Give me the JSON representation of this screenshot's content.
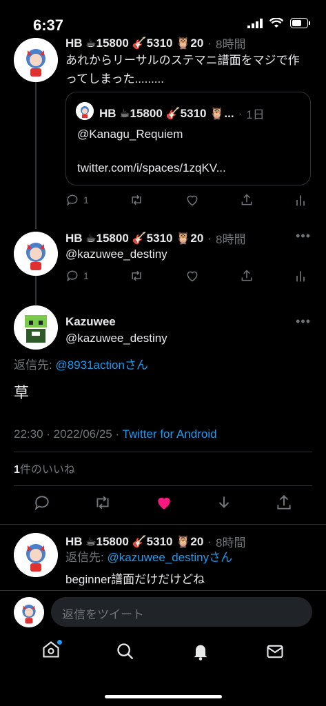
{
  "status_bar": {
    "time": "6:37"
  },
  "top_tweet": {
    "name": "HB ☕15800 🎸5310 🦉20",
    "time": "8時間",
    "text_line1": "あれからリーサルのステマニ譜面をマジで作",
    "text_line2": "ってしまった.........",
    "quote": {
      "name": "HB ☕15800 🎸5310 🦉...",
      "time": "1日",
      "line1": "@Kanagu_Requiem",
      "line2": "twitter.com/i/spaces/1zqKV..."
    },
    "reply_count": "1"
  },
  "second_tweet": {
    "name": "HB ☕15800 🎸5310 🦉20",
    "time": "8時間",
    "mention": "@kazuwee_destiny",
    "reply_count": "1"
  },
  "main_tweet": {
    "name": "Kazuwee",
    "handle": "@kazuwee_destiny",
    "reply_label": "返信先:",
    "reply_to": "@8931actionさん",
    "text": "草",
    "timestamp": "22:30 · 2022/06/25 · ",
    "source": "Twitter for Android",
    "likes_count": "1",
    "likes_label": "件のいいね"
  },
  "reply_tweet": {
    "name": "HB ☕15800 🎸5310 🦉20",
    "time": "8時間",
    "reply_label": "返信先:",
    "reply_to": "@kazuwee_destiny",
    "reply_suffix": "さん",
    "text": "beginner譜面だけだけどね"
  },
  "composer": {
    "placeholder": "返信をツイート"
  },
  "colors": {
    "accent": "#1d9bf0",
    "like": "#f91880",
    "muted": "#71767b"
  }
}
